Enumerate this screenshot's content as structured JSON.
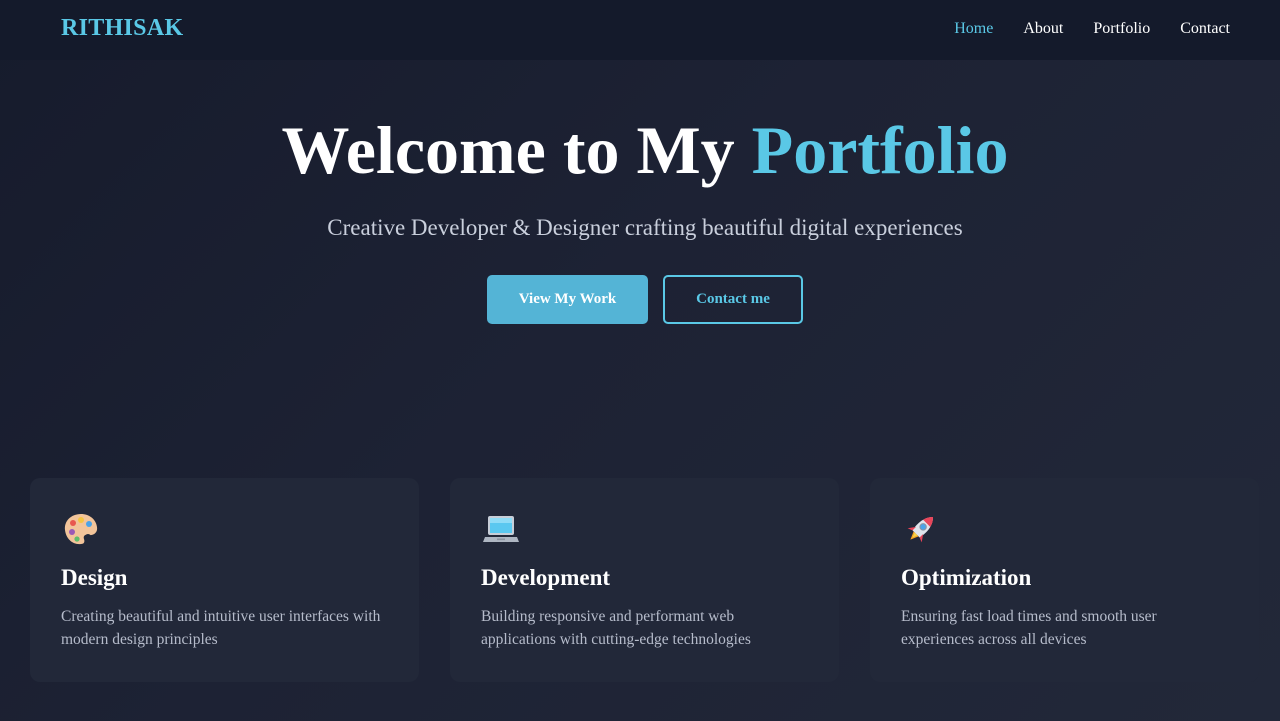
{
  "nav": {
    "brand": "RITHISAK",
    "links": [
      {
        "label": "Home",
        "active": true
      },
      {
        "label": "About",
        "active": false
      },
      {
        "label": "Portfolio",
        "active": false
      },
      {
        "label": "Contact",
        "active": false
      }
    ]
  },
  "hero": {
    "title_main": "Welcome to My ",
    "title_accent": "Portfolio",
    "subtitle": "Creative Developer & Designer crafting beautiful digital experiences",
    "primary_button": "View My Work",
    "secondary_button": "Contact me"
  },
  "cards": [
    {
      "icon": "palette-icon",
      "title": "Design",
      "text": "Creating beautiful and intuitive user interfaces with modern design principles"
    },
    {
      "icon": "laptop-icon",
      "title": "Development",
      "text": "Building responsive and performant web applications with cutting-edge technologies"
    },
    {
      "icon": "rocket-icon",
      "title": "Optimization",
      "text": "Ensuring fast load times and smooth user experiences across all devices"
    }
  ],
  "colors": {
    "accent": "#5ac8e6",
    "button_primary": "#54b4d6",
    "background": "#1b2033",
    "card": "#222839",
    "navbar": "#141a2b"
  }
}
